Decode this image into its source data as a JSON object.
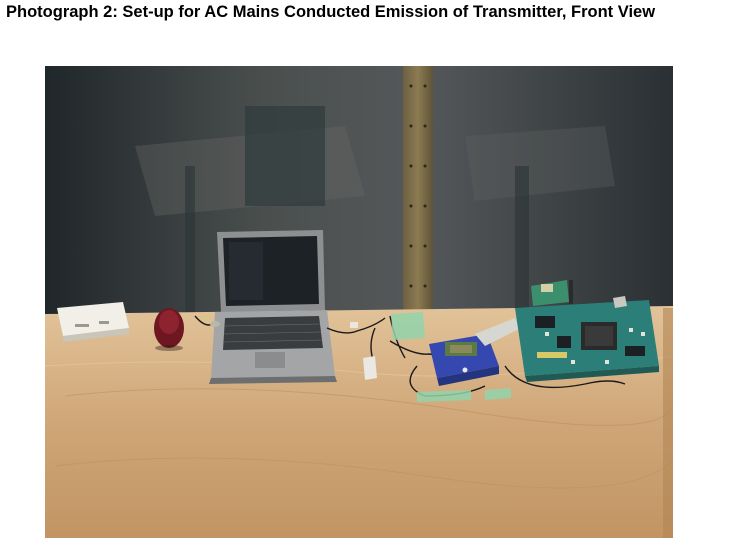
{
  "caption": "Photograph 2: Set-up for AC Mains Conducted Emission of Transmitter, Front View",
  "photo": {
    "colors": {
      "wall": "#3c4244",
      "table_top": "#c9a377",
      "table_edge": "#d8b487",
      "laptop": "#9a9c9e",
      "screen": "#1c2024",
      "board": "#2f7f7a",
      "programmer": "#3b4fb8",
      "tape": "#8fd1a8",
      "mouse": "#7a1d26",
      "box": "#e6e3da"
    }
  }
}
